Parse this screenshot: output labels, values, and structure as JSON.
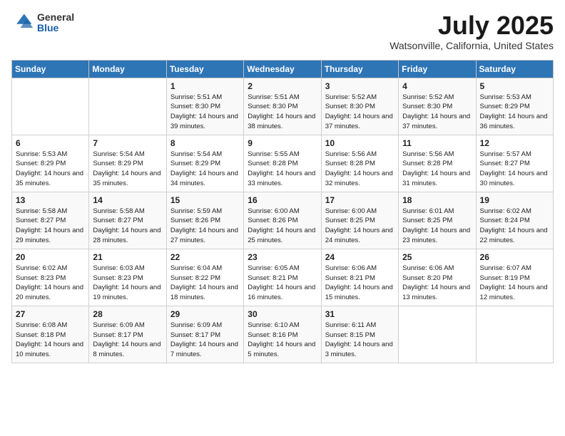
{
  "header": {
    "logo_general": "General",
    "logo_blue": "Blue",
    "month_title": "July 2025",
    "location": "Watsonville, California, United States"
  },
  "days_of_week": [
    "Sunday",
    "Monday",
    "Tuesday",
    "Wednesday",
    "Thursday",
    "Friday",
    "Saturday"
  ],
  "weeks": [
    [
      {
        "day": "",
        "sunrise": "",
        "sunset": "",
        "daylight": ""
      },
      {
        "day": "",
        "sunrise": "",
        "sunset": "",
        "daylight": ""
      },
      {
        "day": "1",
        "sunrise": "Sunrise: 5:51 AM",
        "sunset": "Sunset: 8:30 PM",
        "daylight": "Daylight: 14 hours and 39 minutes."
      },
      {
        "day": "2",
        "sunrise": "Sunrise: 5:51 AM",
        "sunset": "Sunset: 8:30 PM",
        "daylight": "Daylight: 14 hours and 38 minutes."
      },
      {
        "day": "3",
        "sunrise": "Sunrise: 5:52 AM",
        "sunset": "Sunset: 8:30 PM",
        "daylight": "Daylight: 14 hours and 37 minutes."
      },
      {
        "day": "4",
        "sunrise": "Sunrise: 5:52 AM",
        "sunset": "Sunset: 8:30 PM",
        "daylight": "Daylight: 14 hours and 37 minutes."
      },
      {
        "day": "5",
        "sunrise": "Sunrise: 5:53 AM",
        "sunset": "Sunset: 8:29 PM",
        "daylight": "Daylight: 14 hours and 36 minutes."
      }
    ],
    [
      {
        "day": "6",
        "sunrise": "Sunrise: 5:53 AM",
        "sunset": "Sunset: 8:29 PM",
        "daylight": "Daylight: 14 hours and 35 minutes."
      },
      {
        "day": "7",
        "sunrise": "Sunrise: 5:54 AM",
        "sunset": "Sunset: 8:29 PM",
        "daylight": "Daylight: 14 hours and 35 minutes."
      },
      {
        "day": "8",
        "sunrise": "Sunrise: 5:54 AM",
        "sunset": "Sunset: 8:29 PM",
        "daylight": "Daylight: 14 hours and 34 minutes."
      },
      {
        "day": "9",
        "sunrise": "Sunrise: 5:55 AM",
        "sunset": "Sunset: 8:28 PM",
        "daylight": "Daylight: 14 hours and 33 minutes."
      },
      {
        "day": "10",
        "sunrise": "Sunrise: 5:56 AM",
        "sunset": "Sunset: 8:28 PM",
        "daylight": "Daylight: 14 hours and 32 minutes."
      },
      {
        "day": "11",
        "sunrise": "Sunrise: 5:56 AM",
        "sunset": "Sunset: 8:28 PM",
        "daylight": "Daylight: 14 hours and 31 minutes."
      },
      {
        "day": "12",
        "sunrise": "Sunrise: 5:57 AM",
        "sunset": "Sunset: 8:27 PM",
        "daylight": "Daylight: 14 hours and 30 minutes."
      }
    ],
    [
      {
        "day": "13",
        "sunrise": "Sunrise: 5:58 AM",
        "sunset": "Sunset: 8:27 PM",
        "daylight": "Daylight: 14 hours and 29 minutes."
      },
      {
        "day": "14",
        "sunrise": "Sunrise: 5:58 AM",
        "sunset": "Sunset: 8:27 PM",
        "daylight": "Daylight: 14 hours and 28 minutes."
      },
      {
        "day": "15",
        "sunrise": "Sunrise: 5:59 AM",
        "sunset": "Sunset: 8:26 PM",
        "daylight": "Daylight: 14 hours and 27 minutes."
      },
      {
        "day": "16",
        "sunrise": "Sunrise: 6:00 AM",
        "sunset": "Sunset: 8:26 PM",
        "daylight": "Daylight: 14 hours and 25 minutes."
      },
      {
        "day": "17",
        "sunrise": "Sunrise: 6:00 AM",
        "sunset": "Sunset: 8:25 PM",
        "daylight": "Daylight: 14 hours and 24 minutes."
      },
      {
        "day": "18",
        "sunrise": "Sunrise: 6:01 AM",
        "sunset": "Sunset: 8:25 PM",
        "daylight": "Daylight: 14 hours and 23 minutes."
      },
      {
        "day": "19",
        "sunrise": "Sunrise: 6:02 AM",
        "sunset": "Sunset: 8:24 PM",
        "daylight": "Daylight: 14 hours and 22 minutes."
      }
    ],
    [
      {
        "day": "20",
        "sunrise": "Sunrise: 6:02 AM",
        "sunset": "Sunset: 8:23 PM",
        "daylight": "Daylight: 14 hours and 20 minutes."
      },
      {
        "day": "21",
        "sunrise": "Sunrise: 6:03 AM",
        "sunset": "Sunset: 8:23 PM",
        "daylight": "Daylight: 14 hours and 19 minutes."
      },
      {
        "day": "22",
        "sunrise": "Sunrise: 6:04 AM",
        "sunset": "Sunset: 8:22 PM",
        "daylight": "Daylight: 14 hours and 18 minutes."
      },
      {
        "day": "23",
        "sunrise": "Sunrise: 6:05 AM",
        "sunset": "Sunset: 8:21 PM",
        "daylight": "Daylight: 14 hours and 16 minutes."
      },
      {
        "day": "24",
        "sunrise": "Sunrise: 6:06 AM",
        "sunset": "Sunset: 8:21 PM",
        "daylight": "Daylight: 14 hours and 15 minutes."
      },
      {
        "day": "25",
        "sunrise": "Sunrise: 6:06 AM",
        "sunset": "Sunset: 8:20 PM",
        "daylight": "Daylight: 14 hours and 13 minutes."
      },
      {
        "day": "26",
        "sunrise": "Sunrise: 6:07 AM",
        "sunset": "Sunset: 8:19 PM",
        "daylight": "Daylight: 14 hours and 12 minutes."
      }
    ],
    [
      {
        "day": "27",
        "sunrise": "Sunrise: 6:08 AM",
        "sunset": "Sunset: 8:18 PM",
        "daylight": "Daylight: 14 hours and 10 minutes."
      },
      {
        "day": "28",
        "sunrise": "Sunrise: 6:09 AM",
        "sunset": "Sunset: 8:17 PM",
        "daylight": "Daylight: 14 hours and 8 minutes."
      },
      {
        "day": "29",
        "sunrise": "Sunrise: 6:09 AM",
        "sunset": "Sunset: 8:17 PM",
        "daylight": "Daylight: 14 hours and 7 minutes."
      },
      {
        "day": "30",
        "sunrise": "Sunrise: 6:10 AM",
        "sunset": "Sunset: 8:16 PM",
        "daylight": "Daylight: 14 hours and 5 minutes."
      },
      {
        "day": "31",
        "sunrise": "Sunrise: 6:11 AM",
        "sunset": "Sunset: 8:15 PM",
        "daylight": "Daylight: 14 hours and 3 minutes."
      },
      {
        "day": "",
        "sunrise": "",
        "sunset": "",
        "daylight": ""
      },
      {
        "day": "",
        "sunrise": "",
        "sunset": "",
        "daylight": ""
      }
    ]
  ]
}
